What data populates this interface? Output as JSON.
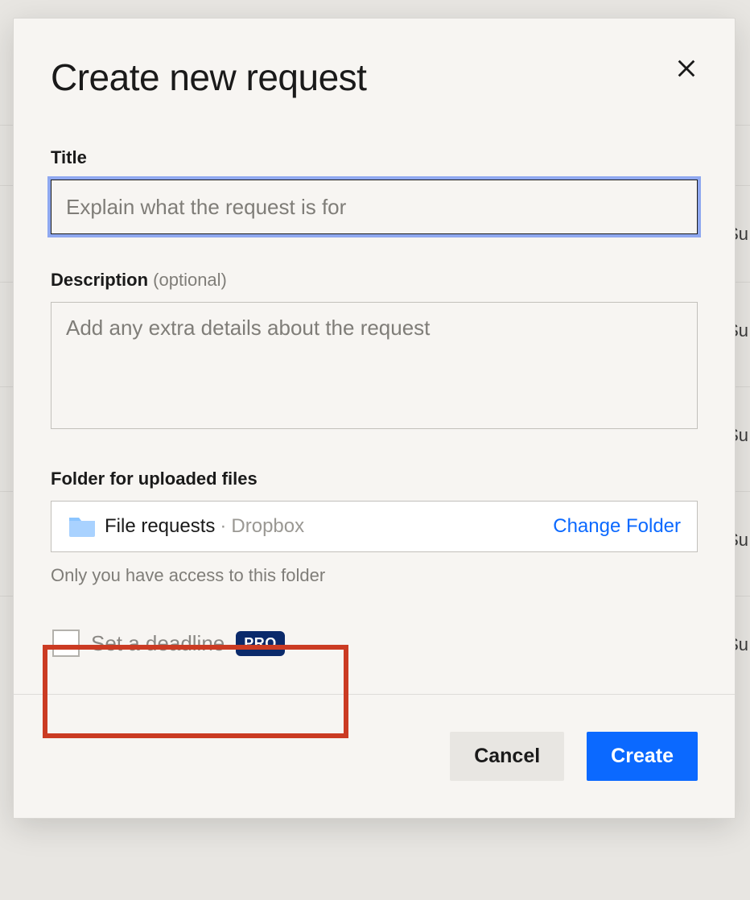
{
  "background": {
    "row_text": "Su"
  },
  "dialog": {
    "title": "Create new request",
    "close_label": "Close",
    "fields": {
      "title": {
        "label": "Title",
        "placeholder": "Explain what the request is for",
        "value": ""
      },
      "description": {
        "label": "Description",
        "optional_suffix": "(optional)",
        "placeholder": "Add any extra details about the request",
        "value": ""
      },
      "folder": {
        "label": "Folder for uploaded files",
        "name": "File requests",
        "separator": "·",
        "path": "Dropbox",
        "change_label": "Change Folder",
        "access_note": "Only you have access to this folder"
      },
      "deadline": {
        "label": "Set a deadline",
        "badge": "PRO",
        "checked": false
      }
    },
    "footer": {
      "cancel": "Cancel",
      "create": "Create"
    }
  }
}
